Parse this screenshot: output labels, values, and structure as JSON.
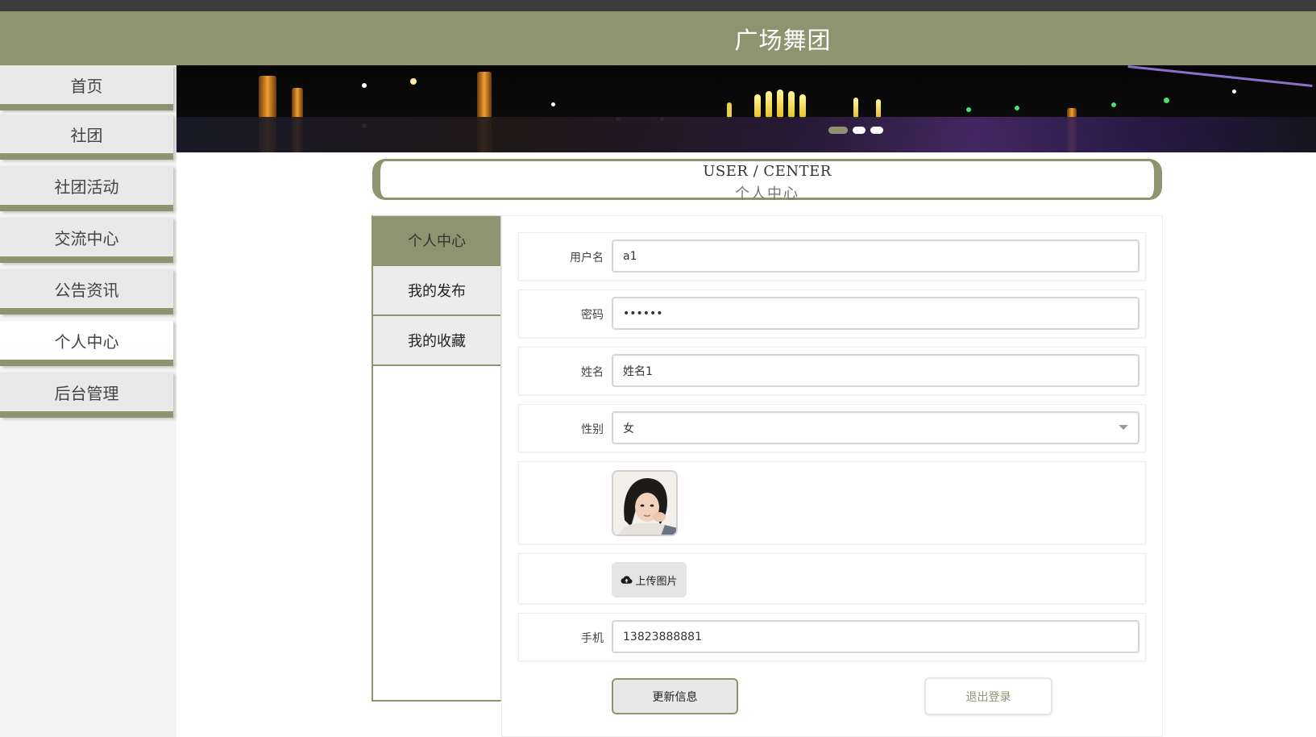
{
  "header": {
    "title": "广场舞团"
  },
  "sidebar": {
    "items": [
      {
        "label": "首页",
        "active": false
      },
      {
        "label": "社团",
        "active": false
      },
      {
        "label": "社团活动",
        "active": false
      },
      {
        "label": "交流中心",
        "active": false
      },
      {
        "label": "公告资讯",
        "active": false
      },
      {
        "label": "个人中心",
        "active": true
      },
      {
        "label": "后台管理",
        "active": false
      }
    ]
  },
  "banner": {
    "slide_count": 3,
    "active_slide": 1
  },
  "section_title": {
    "en": "USER / CENTER",
    "cn": "个人中心"
  },
  "user_menu": {
    "items": [
      {
        "label": "个人中心",
        "active": true
      },
      {
        "label": "我的发布",
        "active": false
      },
      {
        "label": "我的收藏",
        "active": false
      }
    ]
  },
  "form": {
    "username": {
      "label": "用户名",
      "value": "a1"
    },
    "password": {
      "label": "密码",
      "value": "••••••"
    },
    "name": {
      "label": "姓名",
      "value": "姓名1"
    },
    "gender": {
      "label": "性别",
      "value": "女"
    },
    "upload_label": "上传图片",
    "phone": {
      "label": "手机",
      "value": "13823888881"
    }
  },
  "actions": {
    "update": "更新信息",
    "logout": "退出登录"
  },
  "colors": {
    "theme": "#8f9470",
    "header_text": "#ffffff"
  }
}
